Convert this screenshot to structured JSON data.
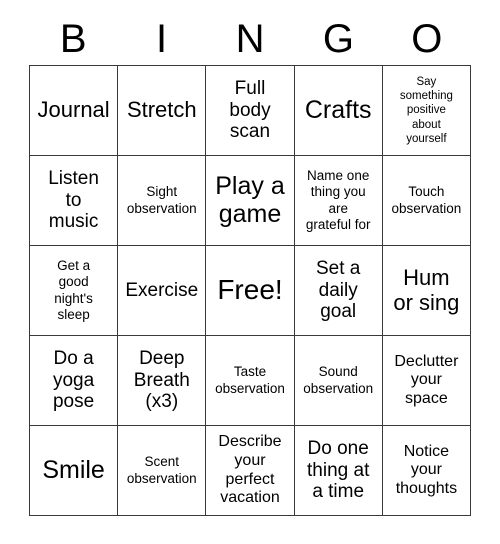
{
  "card": {
    "title": "BINGO",
    "headers": [
      "B",
      "I",
      "N",
      "G",
      "O"
    ],
    "free_space_label": "Free!",
    "colors": {
      "background": "#ffffff",
      "grid_line": "#3a3a3a",
      "text": "#000000"
    },
    "rows": [
      [
        {
          "text": "Journal",
          "size": "sz-xl"
        },
        {
          "text": "Stretch",
          "size": "sz-xl"
        },
        {
          "text": "Full\nbody\nscan",
          "size": "sz-l"
        },
        {
          "text": "Crafts",
          "size": "sz-2xl"
        },
        {
          "text": "Say\nsomething\npositive\nabout\nyourself",
          "size": "sz-xs"
        }
      ],
      [
        {
          "text": "Listen\nto\nmusic",
          "size": "sz-l"
        },
        {
          "text": "Sight\nobservation",
          "size": "sz-s"
        },
        {
          "text": "Play a\ngame",
          "size": "sz-2xl"
        },
        {
          "text": "Name one\nthing you\nare\ngrateful for",
          "size": "sz-s"
        },
        {
          "text": "Touch\nobservation",
          "size": "sz-s"
        }
      ],
      [
        {
          "text": "Get a\ngood\nnight's\nsleep",
          "size": "sz-s"
        },
        {
          "text": "Exercise",
          "size": "sz-l"
        },
        {
          "text": "Free!",
          "size": "sz-3xl"
        },
        {
          "text": "Set a\ndaily\ngoal",
          "size": "sz-l"
        },
        {
          "text": "Hum\nor sing",
          "size": "sz-xl"
        }
      ],
      [
        {
          "text": "Do a\nyoga\npose",
          "size": "sz-l"
        },
        {
          "text": "Deep\nBreath\n(x3)",
          "size": "sz-l"
        },
        {
          "text": "Taste\nobservation",
          "size": "sz-s"
        },
        {
          "text": "Sound\nobservation",
          "size": "sz-s"
        },
        {
          "text": "Declutter\nyour\nspace",
          "size": "sz-m"
        }
      ],
      [
        {
          "text": "Smile",
          "size": "sz-2xl"
        },
        {
          "text": "Scent\nobservation",
          "size": "sz-s"
        },
        {
          "text": "Describe\nyour\nperfect\nvacation",
          "size": "sz-m"
        },
        {
          "text": "Do one\nthing at\na time",
          "size": "sz-l"
        },
        {
          "text": "Notice\nyour\nthoughts",
          "size": "sz-m"
        }
      ]
    ]
  }
}
